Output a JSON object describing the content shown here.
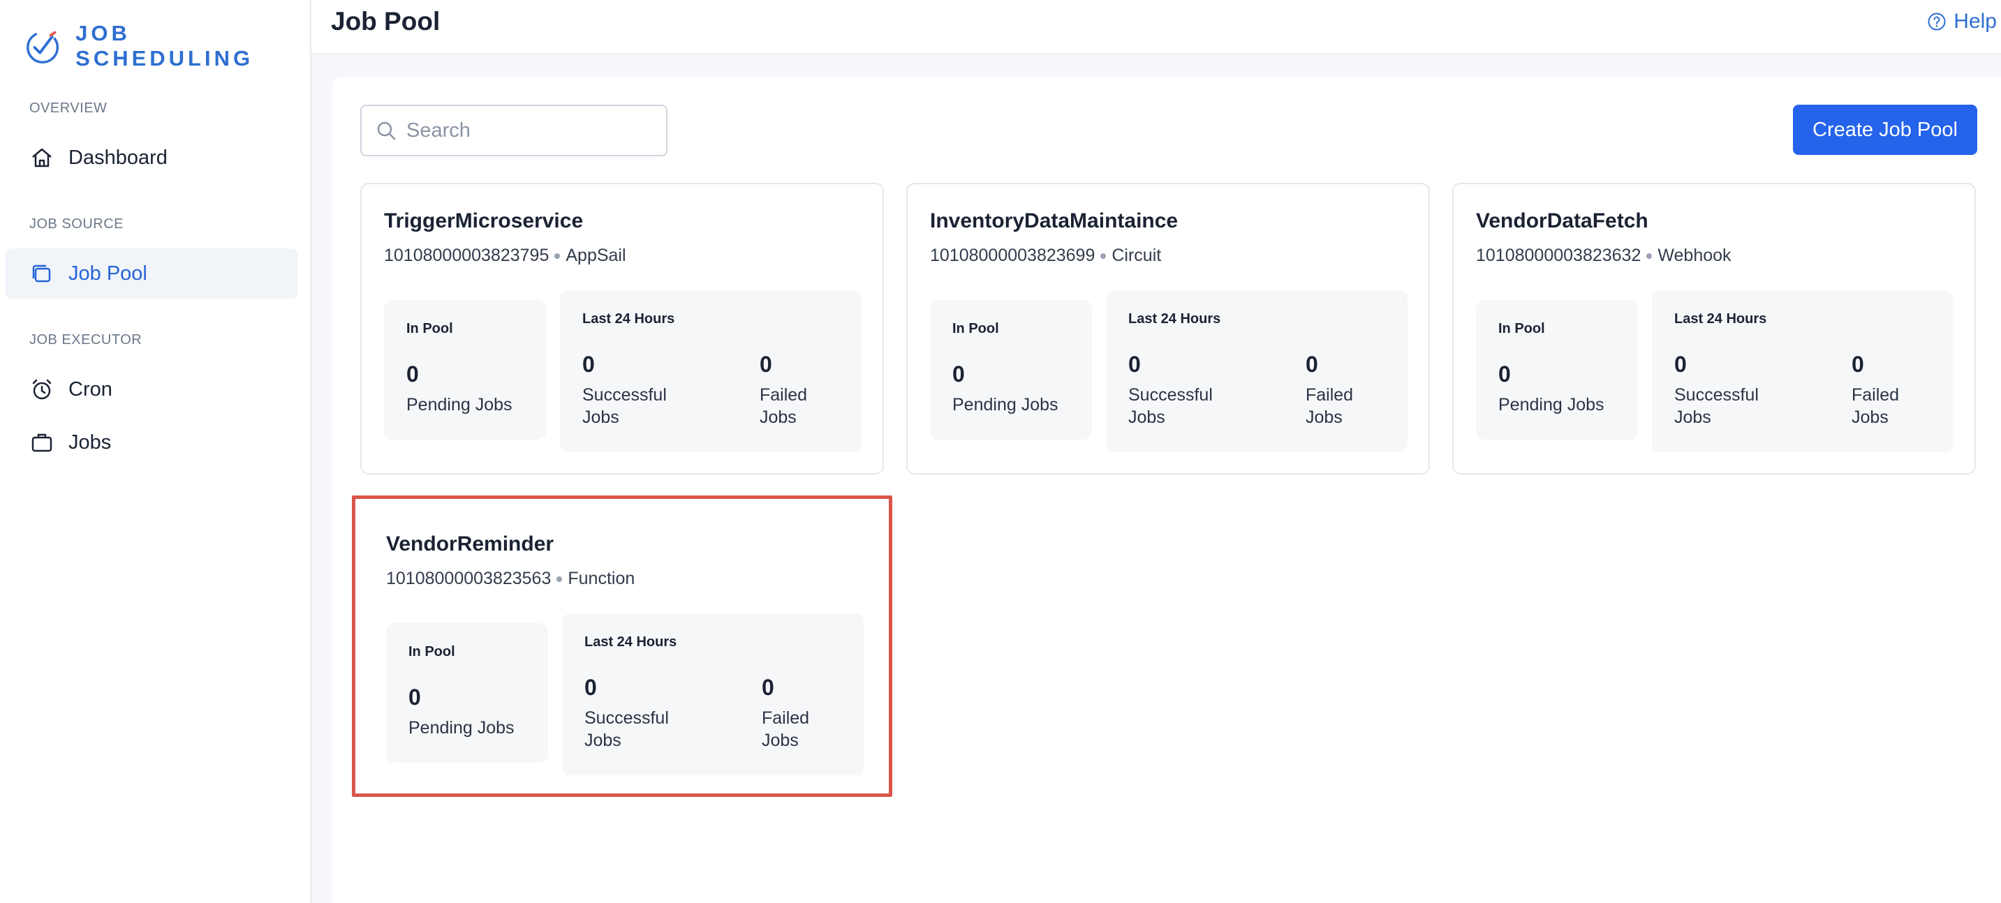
{
  "brand": {
    "name": "JOB SCHEDULING"
  },
  "sidebar": {
    "sections": [
      {
        "label": "OVERVIEW"
      },
      {
        "label": "JOB SOURCE"
      },
      {
        "label": "JOB EXECUTOR"
      }
    ],
    "items": [
      {
        "label": "Dashboard",
        "icon": "home-icon",
        "active": false
      },
      {
        "label": "Job Pool",
        "icon": "layers-icon",
        "active": true
      },
      {
        "label": "Cron",
        "icon": "alarm-clock-icon",
        "active": false
      },
      {
        "label": "Jobs",
        "icon": "briefcase-icon",
        "active": false
      }
    ]
  },
  "header": {
    "title": "Job Pool",
    "help_label": "Help"
  },
  "toolbar": {
    "search_placeholder": "Search",
    "search_value": "",
    "create_label": "Create Job Pool"
  },
  "labels": {
    "in_pool": "In Pool",
    "last_24": "Last 24 Hours",
    "pending": "Pending Jobs",
    "successful_1": "Successful",
    "successful_2": "Jobs",
    "failed_1": "Failed",
    "failed_2": "Jobs"
  },
  "pools": [
    {
      "name": "TriggerMicroservice",
      "id": "10108000003823795",
      "type": "AppSail",
      "pending": "0",
      "successful": "0",
      "failed": "0"
    },
    {
      "name": "InventoryDataMaintaince",
      "id": "10108000003823699",
      "type": "Circuit",
      "pending": "0",
      "successful": "0",
      "failed": "0"
    },
    {
      "name": "VendorDataFetch",
      "id": "10108000003823632",
      "type": "Webhook",
      "pending": "0",
      "successful": "0",
      "failed": "0"
    },
    {
      "name": "VendorReminder",
      "id": "10108000003823563",
      "type": "Function",
      "pending": "0",
      "successful": "0",
      "failed": "0",
      "highlighted": true
    }
  ],
  "colors": {
    "accent": "#2563eb",
    "brand": "#2e6fd1",
    "highlight": "#d9574a"
  }
}
